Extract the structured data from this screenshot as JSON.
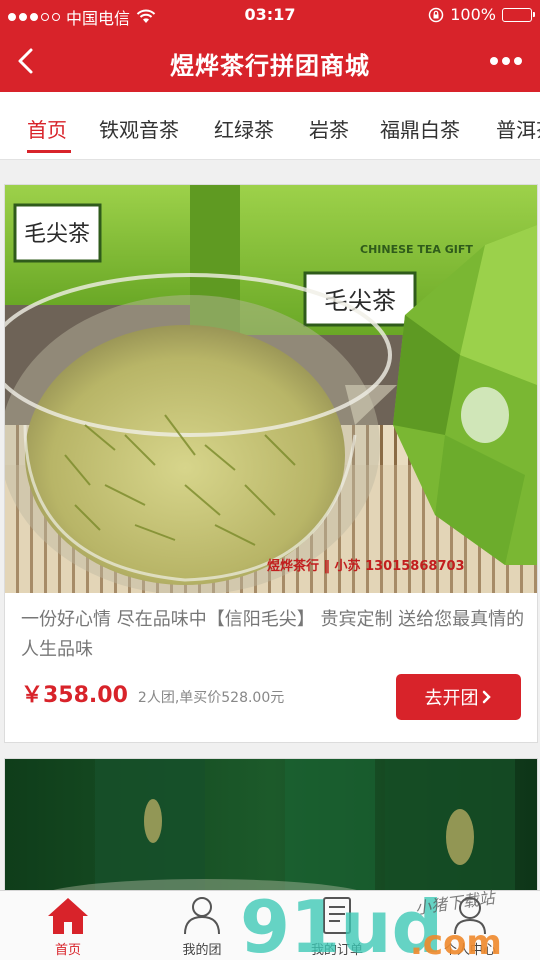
{
  "status_bar": {
    "carrier": "中国电信",
    "time": "03:17",
    "battery": "100%",
    "battery_level": 1.0
  },
  "nav": {
    "title": "煜烨茶行拼团商城",
    "back_icon": "chevron-left-icon",
    "more_icon": "more-dots-icon"
  },
  "tabs": [
    {
      "label": "首页",
      "active": true
    },
    {
      "label": "铁观音茶",
      "active": false
    },
    {
      "label": "红绿茶",
      "active": false
    },
    {
      "label": "岩茶",
      "active": false
    },
    {
      "label": "福鼎白茶",
      "active": false
    },
    {
      "label": "普洱茶",
      "active": false
    }
  ],
  "products": [
    {
      "description": "一份好心情 尽在品味中【信阳毛尖】 贵宾定制 送给您最真情的人生品味",
      "price": "￥358.00",
      "price_note": "2人团,单买价528.00元",
      "button": "去开团",
      "photo_text": {
        "box_label": "毛尖茶",
        "gift_label": "CHINESE TEA GIFT",
        "watermark": "煜烨茶行 ‖ 小苏 13015868703"
      }
    },
    {
      "photo_text": {}
    }
  ],
  "bottom_tabs": [
    {
      "label": "首页",
      "icon": "home-icon",
      "active": true
    },
    {
      "label": "我的团",
      "icon": "group-icon",
      "active": false
    },
    {
      "label": "我的订单",
      "icon": "order-icon",
      "active": false
    },
    {
      "label": "个人中心",
      "icon": "user-icon",
      "active": false
    }
  ],
  "watermark": {
    "text": "91ud",
    "suffix": ".com",
    "script": "小猪下载站"
  },
  "colors": {
    "primary": "#d8232a",
    "tea_green": "#8cc63f"
  }
}
